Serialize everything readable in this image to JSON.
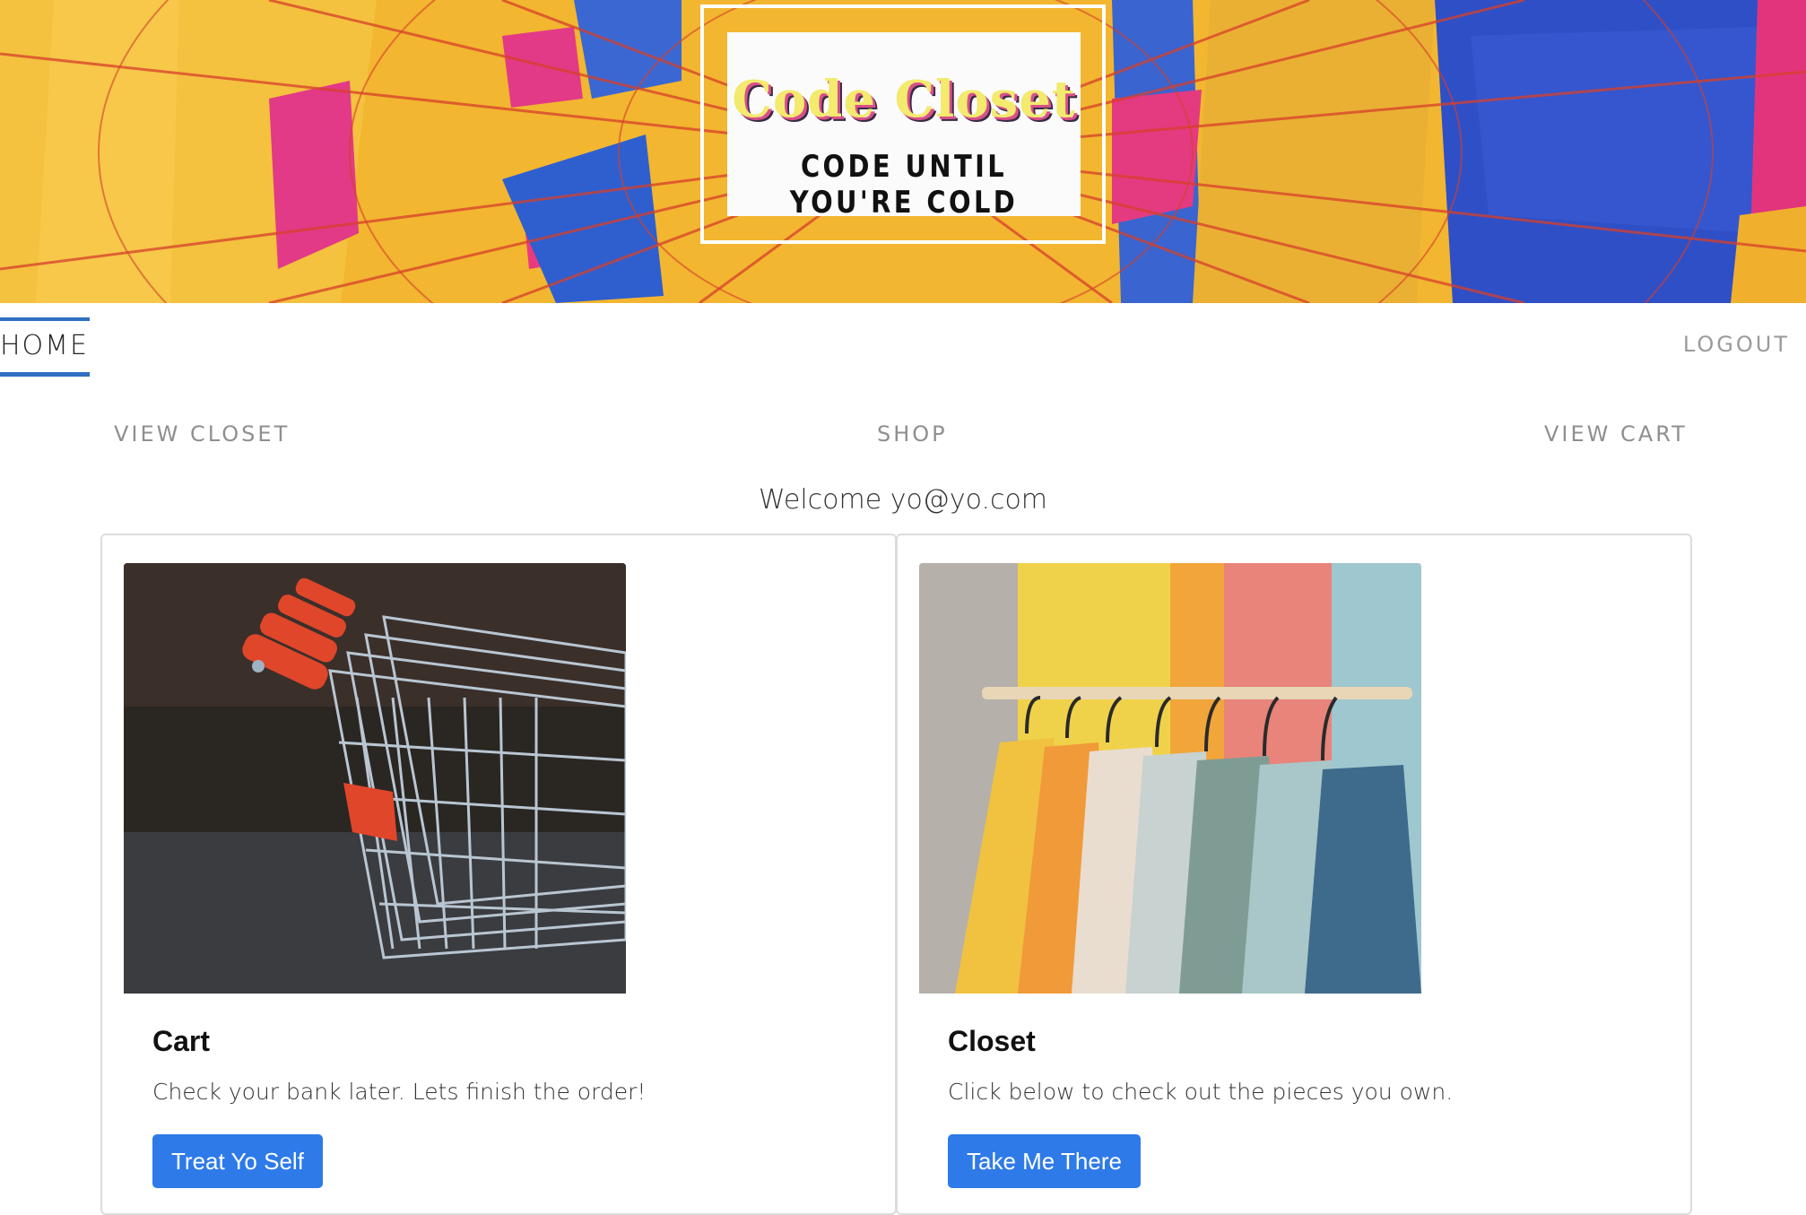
{
  "banner": {
    "logo_title": "Code Closet",
    "logo_tagline": "CODE UNTIL YOU'RE COLD"
  },
  "nav": {
    "home": "HOME",
    "logout": "LOGOUT"
  },
  "subnav": {
    "view_closet": "VIEW CLOSET",
    "shop": "SHOP",
    "view_cart": "VIEW CART"
  },
  "welcome": {
    "prefix": "Welcome",
    "email": "yo@yo.com"
  },
  "cards": [
    {
      "title": "Cart",
      "text": "Check your bank later. Lets finish the order!",
      "button": "Treat Yo Self"
    },
    {
      "title": "Closet",
      "text": "Click below to check out the pieces you own.",
      "button": "Take Me There"
    }
  ],
  "colors": {
    "accent": "#2f6fc2",
    "button": "#2e7ae8",
    "balloon_yellow": "#f2b630",
    "balloon_pink": "#e63a7a",
    "balloon_blue": "#2c58c8"
  }
}
